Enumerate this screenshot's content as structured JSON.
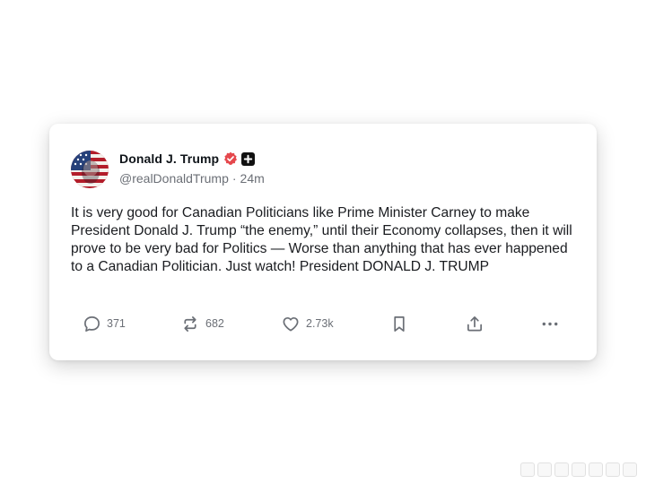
{
  "post": {
    "author_name": "Donald J. Trump",
    "handle": "@realDonaldTrump",
    "separator": "·",
    "time_ago": "24m",
    "verified_icon": "verified-badge-icon",
    "plus_icon": "plus-badge-icon",
    "body": "It is very good for Canadian Politicians like Prime Minister Carney to make President Donald J. Trump “the enemy,” until their Economy collapses, then it will prove to be very bad for Politics — Worse than anything that has ever happened to a Canadian Politician. Just watch! President DONALD J. TRUMP"
  },
  "actions": {
    "reply_count": "371",
    "repost_count": "682",
    "like_count": "2.73k"
  },
  "colors": {
    "verified": "#e5484d",
    "muted_text": "#6b6f76",
    "text": "#1a1c20"
  }
}
